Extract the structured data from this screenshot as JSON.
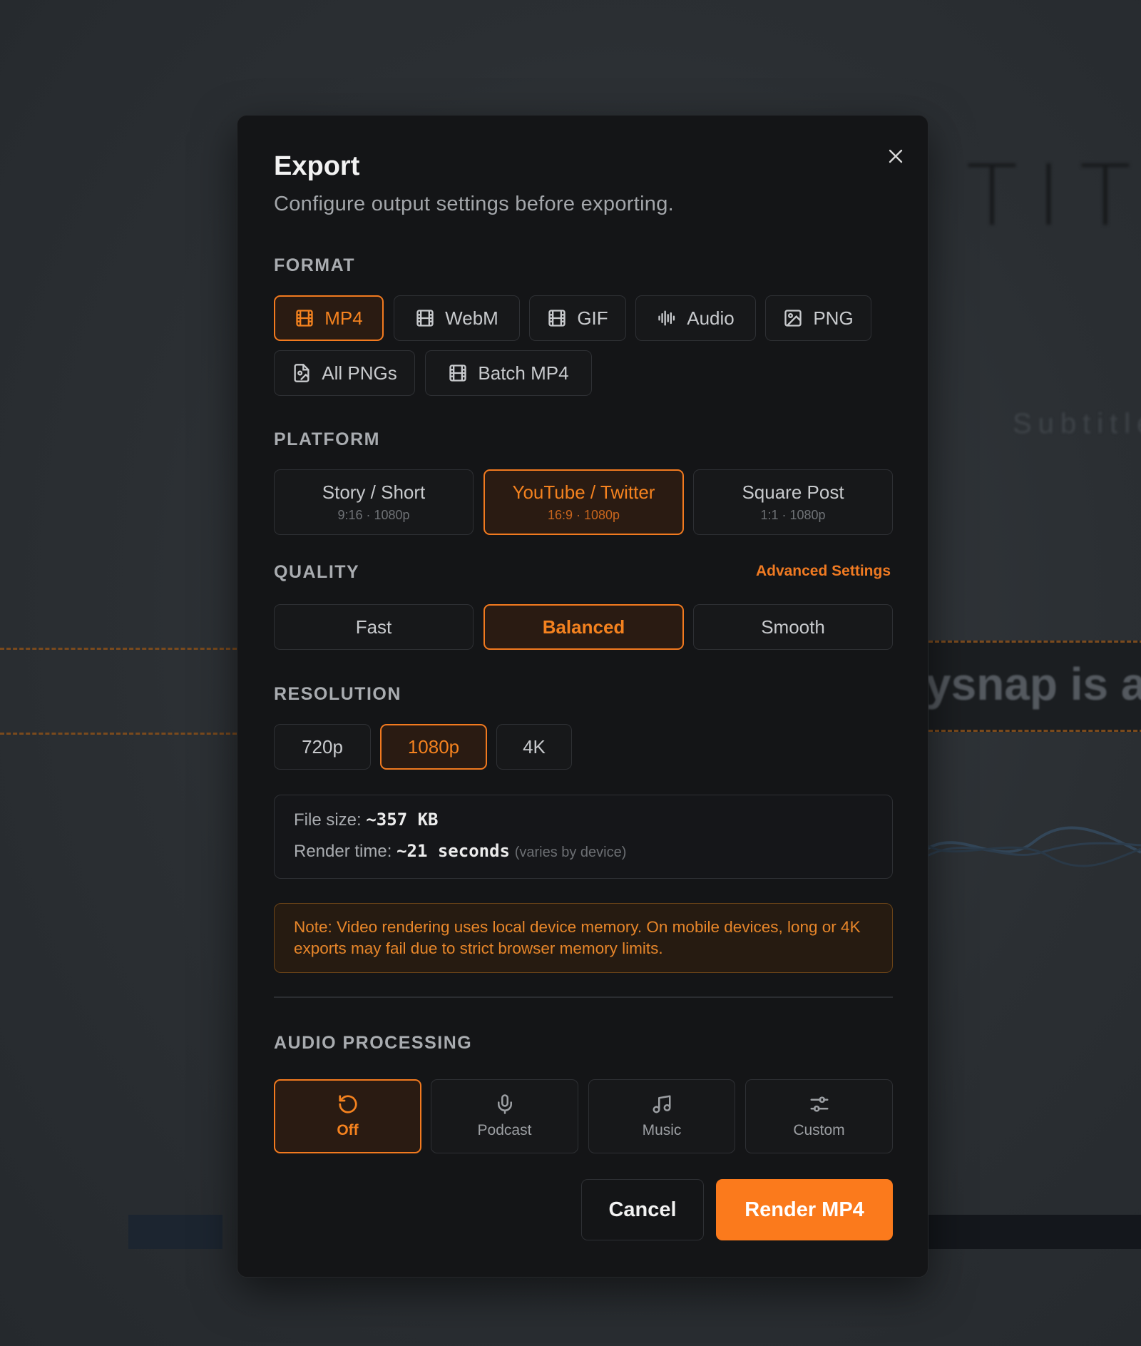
{
  "background": {
    "title_text": "TITL",
    "subtitle_text": "Subtitle",
    "caption_text": "ysnap is a"
  },
  "dialog": {
    "title": "Export",
    "subtitle": "Configure output settings before exporting.",
    "close_icon": "close-icon"
  },
  "format": {
    "label": "FORMAT",
    "options": [
      {
        "label": "MP4",
        "icon": "film-icon",
        "selected": true
      },
      {
        "label": "WebM",
        "icon": "film-icon",
        "selected": false
      },
      {
        "label": "GIF",
        "icon": "film-icon",
        "selected": false
      },
      {
        "label": "Audio",
        "icon": "audio-waveform-icon",
        "selected": false
      },
      {
        "label": "PNG",
        "icon": "image-icon",
        "selected": false
      },
      {
        "label": "All PNGs",
        "icon": "file-image-icon",
        "selected": false
      },
      {
        "label": "Batch MP4",
        "icon": "film-icon",
        "selected": false
      }
    ]
  },
  "platform": {
    "label": "PLATFORM",
    "options": [
      {
        "label": "Story / Short",
        "sub": "9:16 · 1080p",
        "selected": false
      },
      {
        "label": "YouTube / Twitter",
        "sub": "16:9 · 1080p",
        "selected": true
      },
      {
        "label": "Square Post",
        "sub": "1:1 · 1080p",
        "selected": false
      }
    ]
  },
  "quality": {
    "label": "QUALITY",
    "advanced_link": "Advanced Settings",
    "options": [
      {
        "label": "Fast",
        "selected": false
      },
      {
        "label": "Balanced",
        "selected": true
      },
      {
        "label": "Smooth",
        "selected": false
      }
    ]
  },
  "resolution": {
    "label": "RESOLUTION",
    "options": [
      {
        "label": "720p",
        "selected": false
      },
      {
        "label": "1080p",
        "selected": true
      },
      {
        "label": "4K",
        "selected": false
      }
    ]
  },
  "estimate": {
    "file_size_label": "File size:",
    "file_size_value": "~357 KB",
    "render_time_label": "Render time:",
    "render_time_value": "~21 seconds",
    "render_time_note": "(varies by device)"
  },
  "note": {
    "text": "Note: Video rendering uses local device memory. On mobile devices, long or 4K exports may fail due to strict browser memory limits."
  },
  "audio_processing": {
    "label": "AUDIO PROCESSING",
    "options": [
      {
        "label": "Off",
        "icon": "reset-icon",
        "selected": true
      },
      {
        "label": "Podcast",
        "icon": "microphone-icon",
        "selected": false
      },
      {
        "label": "Music",
        "icon": "music-note-icon",
        "selected": false
      },
      {
        "label": "Custom",
        "icon": "sliders-icon",
        "selected": false
      }
    ]
  },
  "actions": {
    "cancel": "Cancel",
    "render": "Render MP4"
  },
  "colors": {
    "accent": "#fb7a1c",
    "selected_bg": "#2a1b12",
    "modal_bg": "#141517",
    "note_text": "#e7862a"
  }
}
